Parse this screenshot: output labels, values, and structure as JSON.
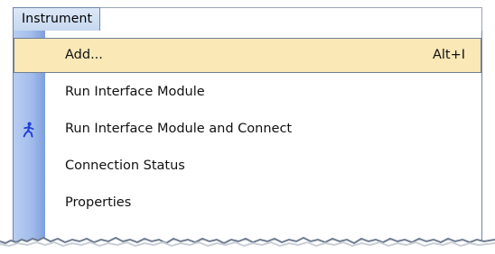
{
  "menubar": {
    "title": "Instrument"
  },
  "menu": {
    "items": [
      {
        "label": "Add...",
        "shortcut": "Alt+I",
        "highlighted": true
      },
      {
        "label": "Run Interface Module"
      },
      {
        "label": "Run Interface Module and Connect",
        "icon": "running-man-icon"
      },
      {
        "label": "Connection Status"
      },
      {
        "label": "Properties"
      }
    ]
  },
  "colors": {
    "highlight": "#fbe8b7",
    "gutter": "#a3bdec",
    "icon": "#1f3fd6"
  }
}
